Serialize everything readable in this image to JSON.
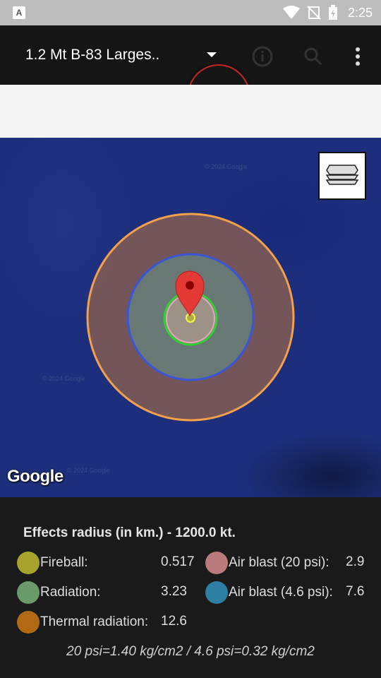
{
  "status_bar": {
    "time": "2:25",
    "notification_icon": "A"
  },
  "toolbar": {
    "title": "1.2 Mt B-83 Larges..",
    "icons": [
      "dropdown-arrow-icon",
      "info-icon",
      "search-icon",
      "overflow-menu-icon"
    ]
  },
  "map": {
    "logo_text": "Google",
    "watermark": "© 2024 Google"
  },
  "effects": {
    "heading": "Effects radius (in km.) - 1200.0 kt.",
    "left": [
      {
        "label": "Fireball:",
        "value": "0.517",
        "color": "#a8a32a"
      },
      {
        "label": "Radiation:",
        "value": "3.23",
        "color": "#6a9a6a"
      },
      {
        "label": "Thermal radiation:",
        "value": "12.6",
        "color": "#b26b14"
      }
    ],
    "right": [
      {
        "label": "Air blast (20 psi):",
        "value": "2.9",
        "color": "#b97b7b"
      },
      {
        "label": "Air blast (4.6 psi):",
        "value": "7.6",
        "color": "#2d7fa3"
      }
    ],
    "footnote": "20 psi=1.40 kg/cm2 / 4.6 psi=0.32 kg/cm2"
  }
}
